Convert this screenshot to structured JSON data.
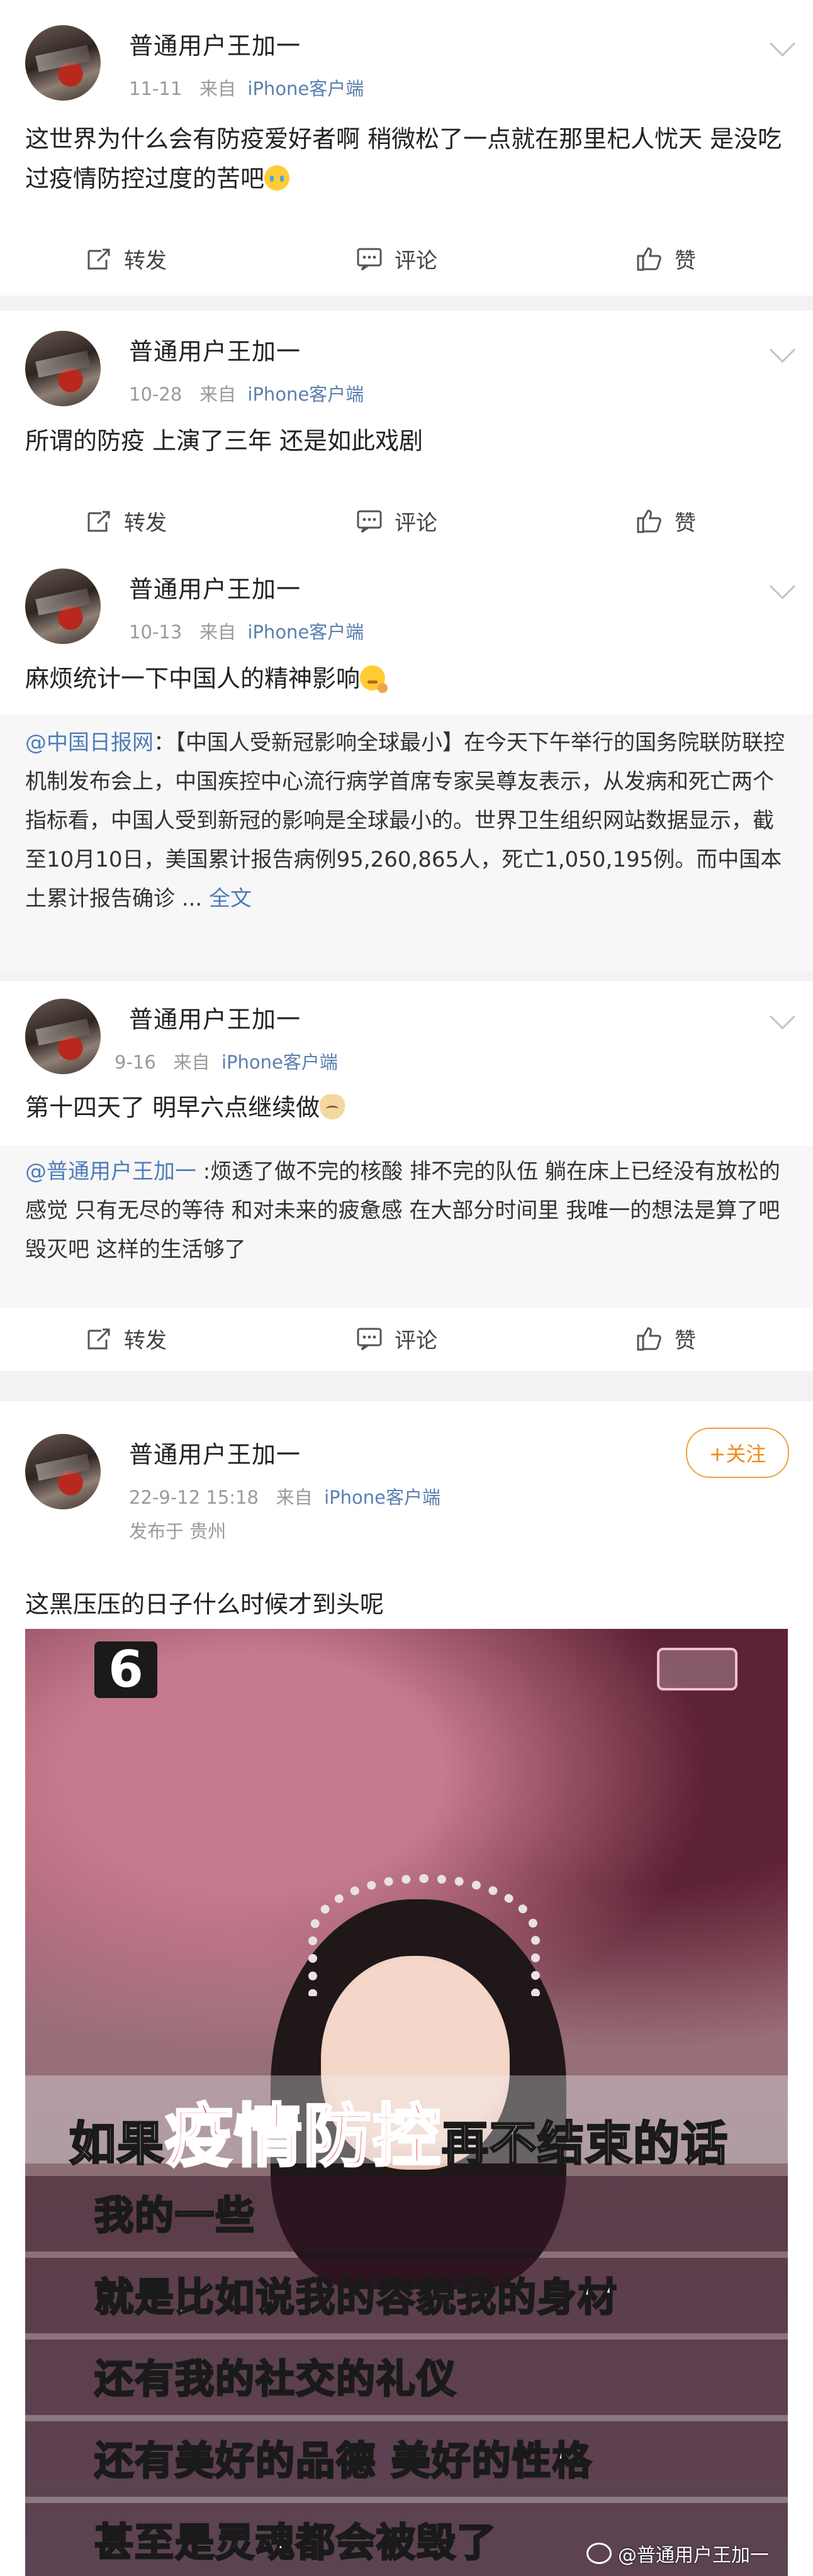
{
  "actions": {
    "repost": "转发",
    "comment": "评论",
    "like": "赞"
  },
  "follow_label": "+关注",
  "posts": [
    {
      "username": "普通用户王加一",
      "date": "11-11",
      "from": "来自",
      "source": "iPhone客户端",
      "text": "这世界为什么会有防疫爱好者啊 稍微松了一点就在那里杞人忧天 是没吃过疫情防控过度的苦吧",
      "emoji": "cry-emoji"
    },
    {
      "username": "普通用户王加一",
      "date": "10-28",
      "from": "来自",
      "source": "iPhone客户端",
      "text": "所谓的防疫 上演了三年 还是如此戏剧"
    },
    {
      "username": "普通用户王加一",
      "date": "10-13",
      "from": "来自",
      "source": "iPhone客户端",
      "text": "麻烦统计一下中国人的精神影响",
      "emoji": "thinking-emoji",
      "repost": {
        "mention": "@中国日报网",
        "body": "：【中国人受新冠影响全球最小】在今天下午举行的国务院联防联控机制发布会上，中国疾控中心流行病学首席专家吴尊友表示，从发病和死亡两个指标看，中国人受到新冠的影响是全球最小的。世界卫生组织网站数据显示，截至10月10日，美国累计报告病例95,260,865人，死亡1,050,195例。而中国本土累计报告确诊 ... ",
        "more": "全文"
      }
    },
    {
      "username": "普通用户王加一",
      "date": "9-16",
      "from": "来自",
      "source": "iPhone客户端",
      "text": "第十四天了 明早六点继续做",
      "emoji": "cat-emoji",
      "repost": {
        "mention": "@普通用户王加一",
        "body": " :烦透了做不完的核酸 排不完的队伍 躺在床上已经没有放松的感觉 只有无尽的等待 和对未来的疲惫感 在大部分时间里 我唯一的想法是算了吧毁灭吧 这样的生活够了"
      }
    },
    {
      "username": "普通用户王加一",
      "date": "22-9-12 15:18",
      "from": "来自",
      "source": "iPhone客户端",
      "location": "发布于 贵州",
      "text": "这黑压压的日子什么时候才到头呢",
      "image": {
        "channel": "6",
        "captions": [
          {
            "prefix": "如果",
            "highlight": "疫情防控",
            "suffix": "再不结束的话"
          },
          {
            "text": "我的一些"
          },
          {
            "text": "就是比如说我的容貌我的身材"
          },
          {
            "text": "还有我的社交的礼仪"
          },
          {
            "text": "还有美好的品德 美好的性格"
          },
          {
            "text": "甚至是灵魂都会被毁了"
          }
        ],
        "watermark": "@普通用户王加一"
      }
    }
  ]
}
